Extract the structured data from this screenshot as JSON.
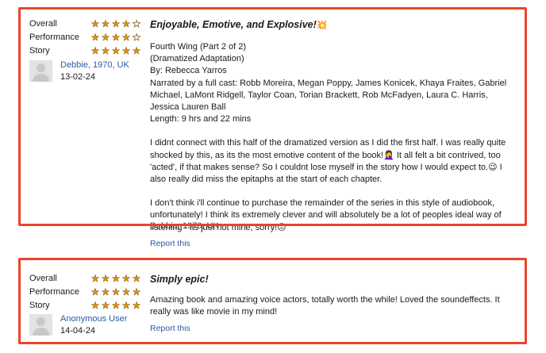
{
  "reviews": [
    {
      "ratings": [
        {
          "label": "Overall",
          "stars": 4
        },
        {
          "label": "Performance",
          "stars": 4
        },
        {
          "label": "Story",
          "stars": 5
        }
      ],
      "reviewer_name": "Debbie, 1970, UK",
      "date": "13-02-24",
      "title": "Enjoyable, Emotive, and Explosive!",
      "title_emoji": "💥",
      "details": "Fourth Wing (Part 2 of 2)\n(Dramatized Adaptation)\nBy: Rebecca Yarros\nNarrated by a full cast: Robb Moreira, Megan Poppy, James Konicek, Khaya Fraites, Gabriel\nMichael, LaMont Ridgell, Taylor Coan, Torian Brackett, Rob McFadyen, Laura C. Harris, Jessica Lauren Ball\nLength: 9 hrs and 22 mins",
      "body1": "I didnt connect with this half of the dramatized version as I did the first half. I was really quite shocked by this, as its the most emotive content of the book!🤦‍♀️ It all felt a bit contrived, too 'acted', if that makes sense? So I couldnt lose myself in the story how I would expect to.😉 I also really did miss the epitaphs at the start of each chapter.",
      "body2": "I don't think i'll continue to purchase the remainder of the series in this style of audiobook, unfortunately! I think its extremely clever and will absolutely be a lot of peoples ideal way of listening - its just not mine, sorry!😑",
      "ghost_text": "Debbie, 1970, UK",
      "report_label": "Report this"
    },
    {
      "ratings": [
        {
          "label": "Overall",
          "stars": 5
        },
        {
          "label": "Performance",
          "stars": 5
        },
        {
          "label": "Story",
          "stars": 5
        }
      ],
      "reviewer_name": "Anonymous User",
      "date": "14-04-24",
      "title": "Simply epic!",
      "body1": "Amazing book and amazing voice actors, totally worth the while! Loved the soundeffects. It really was like movie in my mind!",
      "report_label": "Report this"
    }
  ],
  "colors": {
    "highlight": "#e8452c",
    "link": "#2b5aa8",
    "star": "#e69400"
  }
}
